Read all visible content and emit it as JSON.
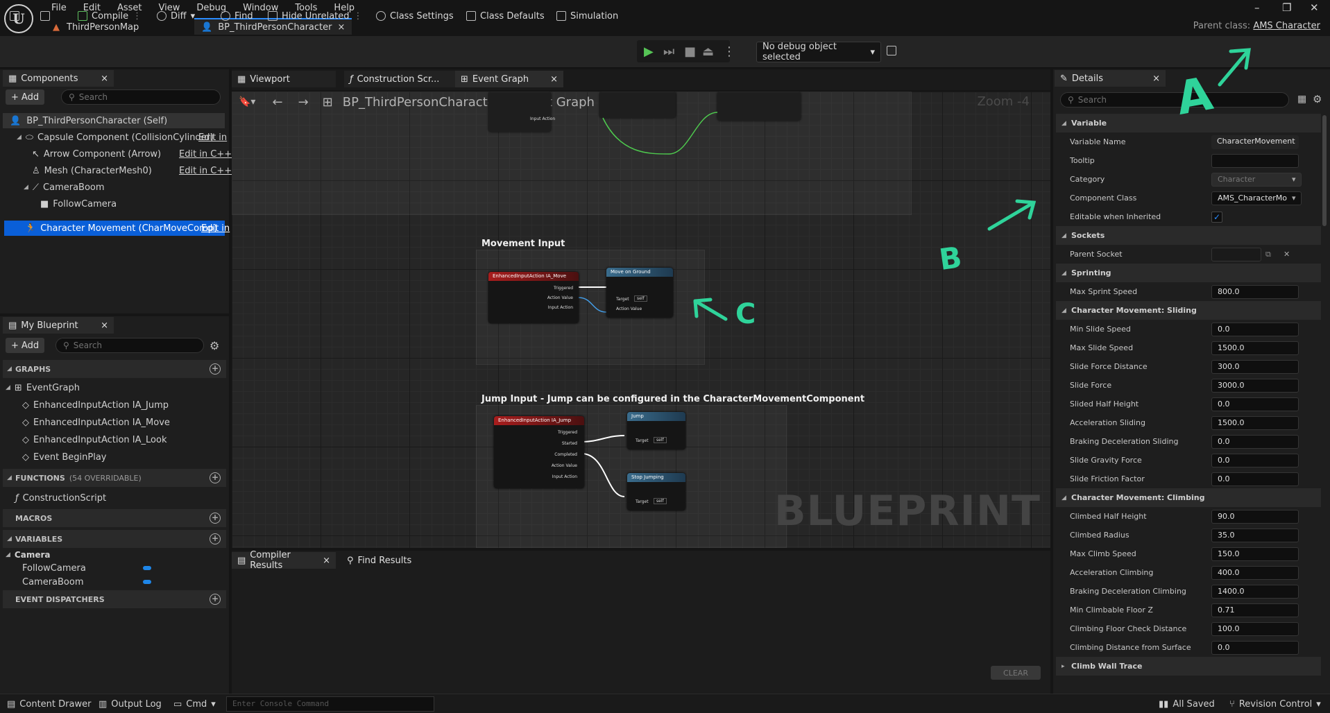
{
  "menu": [
    "File",
    "Edit",
    "Asset",
    "View",
    "Debug",
    "Window",
    "Tools",
    "Help"
  ],
  "doc_tabs": {
    "map": "ThirdPersonMap",
    "blueprint": "BP_ThirdPersonCharacter"
  },
  "parent_class": {
    "label": "Parent class:",
    "value": "AMS Character"
  },
  "toolbar": {
    "compile": "Compile",
    "diff": "Diff",
    "find": "Find",
    "hide_unrelated": "Hide Unrelated",
    "class_settings": "Class Settings",
    "class_defaults": "Class Defaults",
    "simulation": "Simulation",
    "debug_object": "No debug object selected"
  },
  "components": {
    "tab": "Components",
    "add": "Add",
    "search_placeholder": "Search",
    "self": "BP_ThirdPersonCharacter (Self)",
    "items": [
      {
        "label": "Capsule Component (CollisionCylinder)",
        "edit": "Edit in"
      },
      {
        "label": "Arrow Component (Arrow)",
        "edit": "Edit in C++"
      },
      {
        "label": "Mesh (CharacterMesh0)",
        "edit": "Edit in C++"
      },
      {
        "label": "CameraBoom",
        "edit": ""
      },
      {
        "label": "FollowCamera",
        "edit": ""
      },
      {
        "label": "Character Movement (CharMoveComp)",
        "edit": "Edit in"
      }
    ]
  },
  "my_blueprint": {
    "tab": "My Blueprint",
    "add": "Add",
    "search_placeholder": "Search",
    "graphs_header": "GRAPHS",
    "event_graph": "EventGraph",
    "events": [
      "EnhancedInputAction IA_Jump",
      "EnhancedInputAction IA_Move",
      "EnhancedInputAction IA_Look",
      "Event BeginPlay"
    ],
    "functions_header": "FUNCTIONS",
    "functions_count": "(54 OVERRIDABLE)",
    "construction_script": "ConstructionScript",
    "macros_header": "MACROS",
    "variables_header": "VARIABLES",
    "camera_category": "Camera",
    "variables": [
      "FollowCamera",
      "CameraBoom"
    ],
    "dispatchers_header": "EVENT DISPATCHERS"
  },
  "graph_tabs": [
    "Viewport",
    "Construction Scr...",
    "Event Graph"
  ],
  "breadcrumb": {
    "root": "BP_ThirdPersonCharacter",
    "current": "Event Graph"
  },
  "zoom": "Zoom -4",
  "watermark": "BLUEPRINT",
  "comments": {
    "movement": "Movement Input",
    "jump": "Jump Input - Jump can be configured in the CharacterMovementComponent"
  },
  "nodes": {
    "move_event": "EnhancedInputAction IA_Move",
    "move_ground": "Move on Ground",
    "jump_event": "EnhancedInputAction IA_Jump",
    "jump": "Jump",
    "stop_jump": "Stop Jumping",
    "pins": {
      "triggered": "Triggered",
      "started": "Started",
      "completed": "Completed",
      "action_value": "Action Value",
      "input_action": "Input Action",
      "target": "Target",
      "self": "self"
    }
  },
  "bottom_tabs": {
    "compiler": "Compiler Results",
    "find": "Find Results",
    "clear": "CLEAR"
  },
  "details": {
    "tab": "Details",
    "search_placeholder": "Search",
    "sections": {
      "variable": "Variable",
      "sockets": "Sockets",
      "sprinting": "Sprinting",
      "sliding": "Character Movement: Sliding",
      "climbing": "Character Movement: Climbing",
      "climb_wall_trace": "Climb Wall Trace"
    },
    "variable_rows": [
      {
        "label": "Variable Name",
        "value": "CharacterMovement"
      },
      {
        "label": "Tooltip",
        "value": ""
      },
      {
        "label": "Category",
        "value": "Character"
      },
      {
        "label": "Component Class",
        "value": "AMS_CharacterMo"
      },
      {
        "label": "Editable when Inherited",
        "value": "✓"
      }
    ],
    "socket_rows": [
      {
        "label": "Parent Socket",
        "value": ""
      }
    ],
    "sprint_rows": [
      {
        "label": "Max Sprint Speed",
        "value": "800.0"
      }
    ],
    "sliding_rows": [
      {
        "label": "Min Slide Speed",
        "value": "0.0"
      },
      {
        "label": "Max Slide Speed",
        "value": "1500.0"
      },
      {
        "label": "Slide Force Distance",
        "value": "300.0"
      },
      {
        "label": "Slide Force",
        "value": "3000.0"
      },
      {
        "label": "Slided Half Height",
        "value": "0.0"
      },
      {
        "label": "Acceleration Sliding",
        "value": "1500.0"
      },
      {
        "label": "Braking Deceleration Sliding",
        "value": "0.0"
      },
      {
        "label": "Slide Gravity Force",
        "value": "0.0"
      },
      {
        "label": "Slide Friction Factor",
        "value": "0.0"
      }
    ],
    "climbing_rows": [
      {
        "label": "Climbed Half Height",
        "value": "90.0"
      },
      {
        "label": "Climbed Radius",
        "value": "35.0"
      },
      {
        "label": "Max Climb Speed",
        "value": "150.0"
      },
      {
        "label": "Acceleration Climbing",
        "value": "400.0"
      },
      {
        "label": "Braking Deceleration Climbing",
        "value": "1400.0"
      },
      {
        "label": "Min Climbable Floor Z",
        "value": "0.71"
      },
      {
        "label": "Climbing Floor Check Distance",
        "value": "100.0"
      },
      {
        "label": "Climbing Distance from Surface",
        "value": "0.0"
      }
    ]
  },
  "annotations": {
    "a": "A",
    "b": "B",
    "c": "C",
    "color": "#2fd39a"
  },
  "statusbar": {
    "content_drawer": "Content Drawer",
    "output_log": "Output Log",
    "cmd": "Cmd",
    "console_placeholder": "Enter Console Command",
    "all_saved": "All Saved",
    "revision_control": "Revision Control"
  }
}
